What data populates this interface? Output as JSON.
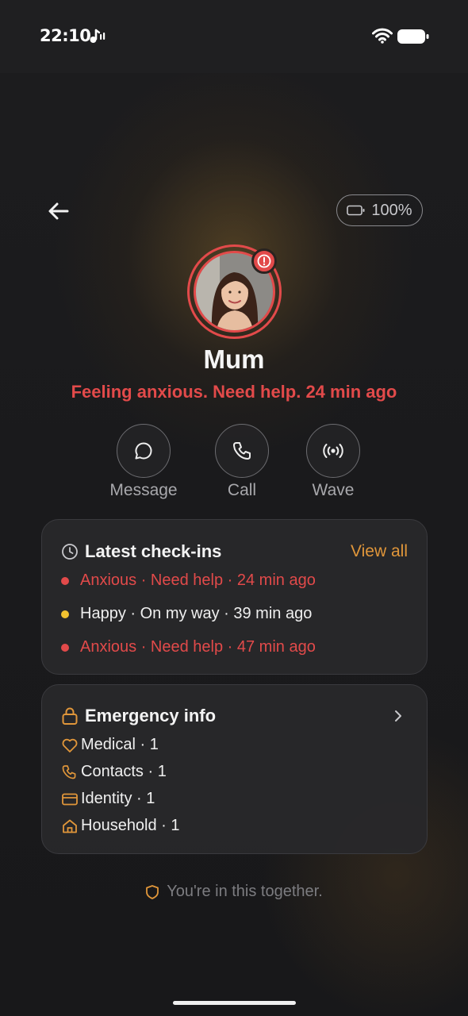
{
  "statusbar": {
    "time": "22:10"
  },
  "header": {
    "battery_label": "100%"
  },
  "profile": {
    "name": "Mum",
    "status": "Feeling anxious. Need help. 24 min ago"
  },
  "actions": [
    {
      "label": "Message",
      "icon": "message-icon"
    },
    {
      "label": "Call",
      "icon": "phone-icon"
    },
    {
      "label": "Wave",
      "icon": "wave-icon"
    }
  ],
  "checkins": {
    "title": "Latest check-ins",
    "view_all": "View all",
    "items": [
      {
        "text": "Anxious · Need help · 24 min ago",
        "color": "#e24a4a"
      },
      {
        "text": "Happy · On my way · 39 min ago",
        "color": "#f2c230"
      },
      {
        "text": "Anxious · Need help · 47 min ago",
        "color": "#e24a4a"
      }
    ]
  },
  "emergency": {
    "title": "Emergency info",
    "items": [
      {
        "label": "Medical · 1",
        "icon": "heart-icon"
      },
      {
        "label": "Contacts · 1",
        "icon": "phone-icon"
      },
      {
        "label": "Identity · 1",
        "icon": "id-card-icon"
      },
      {
        "label": "Household · 1",
        "icon": "house-icon"
      }
    ]
  },
  "footer": {
    "note": "You're in this together."
  },
  "colors": {
    "accent": "#e0963a",
    "alert": "#e24a4a",
    "happy": "#f2c230"
  }
}
